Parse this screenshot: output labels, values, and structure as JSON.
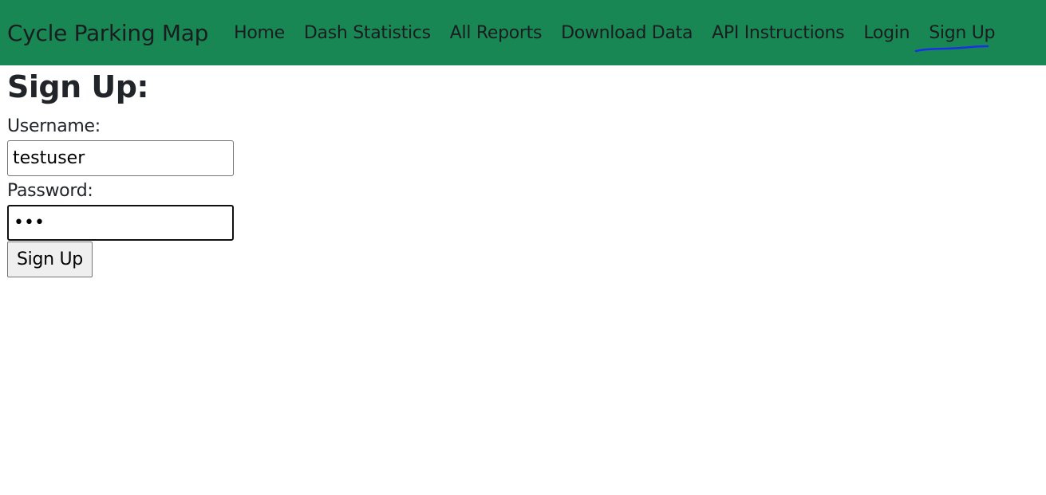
{
  "navbar": {
    "brand": "Cycle Parking Map",
    "links": [
      {
        "label": "Home"
      },
      {
        "label": "Dash Statistics"
      },
      {
        "label": "All Reports"
      },
      {
        "label": "Download Data"
      },
      {
        "label": "API Instructions"
      },
      {
        "label": "Login"
      },
      {
        "label": "Sign Up"
      }
    ],
    "background_color": "#198754",
    "annotation_color": "#1a2fe6"
  },
  "form": {
    "title": "Sign Up:",
    "username_label": "Username:",
    "username_value": "testuser",
    "password_label": "Password:",
    "password_value": "•••",
    "submit_label": "Sign Up"
  }
}
